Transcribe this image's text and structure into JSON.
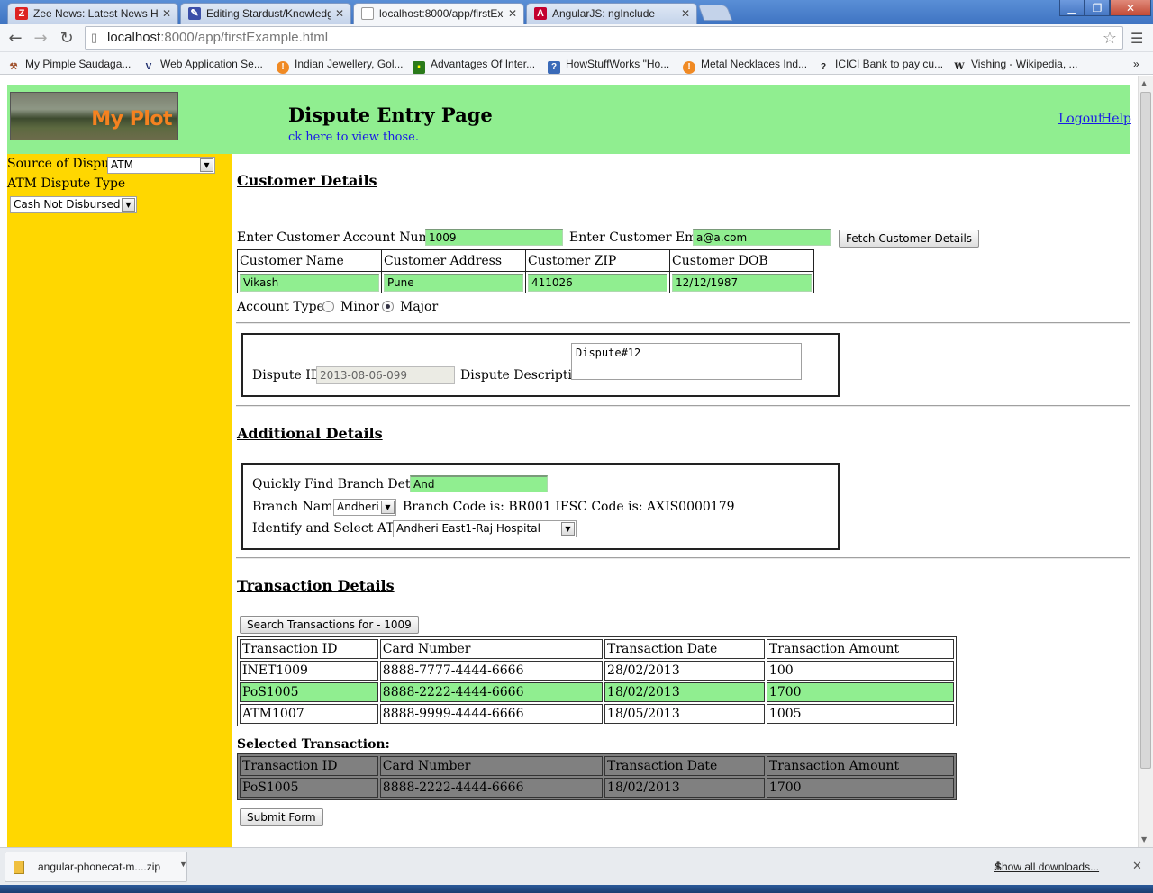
{
  "browser": {
    "tabs": [
      {
        "label": "Zee News: Latest News He",
        "icon": "zee-news-icon",
        "active": false
      },
      {
        "label": "Editing Stardust/Knowledg",
        "icon": "editor-icon",
        "active": false
      },
      {
        "label": "localhost:8000/app/firstEx",
        "icon": "page-icon",
        "active": true
      },
      {
        "label": "AngularJS: ngInclude",
        "icon": "angular-icon",
        "active": false
      }
    ],
    "url_host": "localhost",
    "url_rest": ":8000/app/firstExample.html",
    "bookmarks": [
      {
        "label": "My Pimple Saudaga...",
        "icon": "tools-icon"
      },
      {
        "label": "Web Application Se...",
        "icon": "v-icon"
      },
      {
        "label": "Indian Jewellery, Gol...",
        "icon": "orange-circle-icon"
      },
      {
        "label": "Advantages Of Inter...",
        "icon": "green-square-icon"
      },
      {
        "label": "HowStuffWorks \"Ho...",
        "icon": "question-icon"
      },
      {
        "label": "Metal Necklaces Ind...",
        "icon": "orange-circle-icon"
      },
      {
        "label": "ICICI Bank to pay cu...",
        "icon": "question-mark-icon"
      },
      {
        "label": "Vishing - Wikipedia, ...",
        "icon": "wikipedia-icon"
      }
    ],
    "bookmarks_overflow": "»"
  },
  "header": {
    "logo_text": "My Plot",
    "title": "Dispute Entry Page",
    "subtitle": "ck here to view those.",
    "logout": "Logout",
    "help": "Help"
  },
  "sidebar": {
    "source_label": "Source of Dispute",
    "source_value": "ATM",
    "type_label": "ATM Dispute Type",
    "type_value": "Cash Not Disbursed"
  },
  "customer": {
    "section_title": "Customer Details",
    "account_label": "Enter Customer Account Number",
    "account_value": "1009",
    "email_label": "Enter Customer Email",
    "email_value": "a@a.com",
    "fetch_button": "Fetch Customer Details",
    "headers": [
      "Customer Name",
      "Customer Address",
      "Customer ZIP",
      "Customer DOB"
    ],
    "values": [
      "Vikash",
      "Pune",
      "411026",
      "12/12/1987"
    ],
    "account_type_label": "Account Type",
    "minor_label": "Minor",
    "major_label": "Major"
  },
  "dispute": {
    "id_label": "Dispute ID",
    "id_value": "2013-08-06-099",
    "desc_label": "Dispute Description",
    "desc_value": "Dispute#12"
  },
  "additional": {
    "section_title": "Additional Details",
    "find_label": "Quickly Find Branch Details",
    "find_value": "And",
    "branch_label": "Branch Name",
    "branch_value": "Andheri",
    "branch_info": "Branch Code is: BR001 IFSC Code is: AXIS0000179",
    "atm_label": "Identify and Select ATM",
    "atm_value": "Andheri East1-Raj Hospital"
  },
  "transactions": {
    "section_title": "Transaction Details",
    "search_button": "Search Transactions for - 1009",
    "headers": [
      "Transaction ID",
      "Card Number",
      "Transaction Date",
      "Transaction Amount"
    ],
    "rows": [
      [
        "INET1009",
        "8888-7777-4444-6666",
        "28/02/2013",
        "100"
      ],
      [
        "PoS1005",
        "8888-2222-4444-6666",
        "18/02/2013",
        "1700"
      ],
      [
        "ATM1007",
        "8888-9999-4444-6666",
        "18/05/2013",
        "1005"
      ]
    ],
    "selected_label": "Selected Transaction:",
    "selected_headers": [
      "Transaction ID",
      "Card Number",
      "Transaction Date",
      "Transaction Amount"
    ],
    "selected_row": [
      "PoS1005",
      "8888-2222-4444-6666",
      "18/02/2013",
      "1700"
    ],
    "submit_button": "Submit Form"
  },
  "downloads": {
    "file_name": "angular-phonecat-m....zip",
    "show_all": "Show all downloads..."
  },
  "colors": {
    "header_bg": "#90ee90",
    "sidebar_bg": "#ffd700",
    "highlight_row": "#90ee90",
    "selected_table_bg": "#808080",
    "link": "#1a1ae6"
  }
}
